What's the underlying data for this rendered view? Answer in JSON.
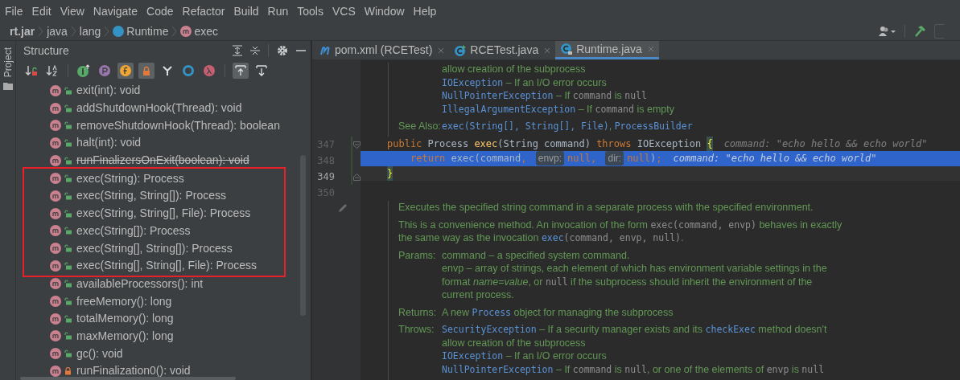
{
  "menu": [
    {
      "label": "File"
    },
    {
      "label": "Edit"
    },
    {
      "label": "View"
    },
    {
      "label": "Navigate"
    },
    {
      "label": "Code"
    },
    {
      "label": "Refactor"
    },
    {
      "label": "Build"
    },
    {
      "label": "Run"
    },
    {
      "label": "Tools"
    },
    {
      "label": "VCS"
    },
    {
      "label": "Window"
    },
    {
      "label": "Help"
    }
  ],
  "breadcrumb": [
    {
      "label": "rt.jar",
      "kind": "jar"
    },
    {
      "label": "java",
      "kind": "package"
    },
    {
      "label": "lang",
      "kind": "package"
    },
    {
      "label": "Runtime",
      "kind": "class"
    },
    {
      "label": "exec",
      "kind": "method"
    }
  ],
  "side_strip": {
    "label": "Project"
  },
  "structure": {
    "title": "Structure",
    "toolbar": [
      {
        "kind": "sort-visibility",
        "on": false
      },
      {
        "kind": "sort-alpha",
        "on": false
      },
      {
        "kind": "inherited",
        "on": false
      },
      {
        "kind": "properties",
        "on": false
      },
      {
        "kind": "fields",
        "on": true
      },
      {
        "kind": "non-public",
        "on": true
      },
      {
        "kind": "anonymous",
        "on": false
      },
      {
        "kind": "interface",
        "on": false
      },
      {
        "kind": "lambda",
        "on": false
      },
      {
        "kind": "scroll-to-source",
        "on": true
      },
      {
        "kind": "scroll-from-source",
        "on": false
      }
    ],
    "items": [
      {
        "label": "exit(int): void",
        "private": false,
        "deprecated": false,
        "boxed": false
      },
      {
        "label": "addShutdownHook(Thread): void",
        "private": false,
        "deprecated": false,
        "boxed": false
      },
      {
        "label": "removeShutdownHook(Thread): boolean",
        "private": false,
        "deprecated": false,
        "boxed": false
      },
      {
        "label": "halt(int): void",
        "private": false,
        "deprecated": false,
        "boxed": false
      },
      {
        "label": "runFinalizersOnExit(boolean): void",
        "private": false,
        "deprecated": true,
        "boxed": false
      },
      {
        "label": "exec(String): Process",
        "private": false,
        "deprecated": false,
        "boxed": true
      },
      {
        "label": "exec(String, String[]): Process",
        "private": false,
        "deprecated": false,
        "boxed": true
      },
      {
        "label": "exec(String, String[], File): Process",
        "private": false,
        "deprecated": false,
        "boxed": true
      },
      {
        "label": "exec(String[]): Process",
        "private": false,
        "deprecated": false,
        "boxed": true
      },
      {
        "label": "exec(String[], String[]): Process",
        "private": false,
        "deprecated": false,
        "boxed": true
      },
      {
        "label": "exec(String[], String[], File): Process",
        "private": false,
        "deprecated": false,
        "boxed": true
      },
      {
        "label": "availableProcessors(): int",
        "private": false,
        "deprecated": false,
        "boxed": false
      },
      {
        "label": "freeMemory(): long",
        "private": false,
        "deprecated": false,
        "boxed": false
      },
      {
        "label": "totalMemory(): long",
        "private": false,
        "deprecated": false,
        "boxed": false
      },
      {
        "label": "maxMemory(): long",
        "private": false,
        "deprecated": false,
        "boxed": false
      },
      {
        "label": "gc(): void",
        "private": false,
        "deprecated": false,
        "boxed": false
      },
      {
        "label": "runFinalization0(): void",
        "private": true,
        "deprecated": false,
        "boxed": false
      }
    ]
  },
  "tabs": [
    {
      "label": "pom.xml (RCETest)",
      "kind": "maven",
      "selected": false
    },
    {
      "label": "RCETest.java",
      "kind": "class",
      "selected": false
    },
    {
      "label": "Runtime.java",
      "kind": "readonly-class",
      "selected": true
    }
  ],
  "doc_top": {
    "sections": [
      {
        "lines": [
          [
            {
              "kind": "text",
              "text": "allow creation of the subprocess"
            }
          ],
          [
            {
              "kind": "link",
              "text": "IOException"
            },
            {
              "kind": "text",
              "text": " – If an I/O error occurs"
            }
          ],
          [
            {
              "kind": "link",
              "text": "NullPointerException"
            },
            {
              "kind": "text",
              "text": " – If "
            },
            {
              "kind": "code",
              "text": "command"
            },
            {
              "kind": "text",
              "text": " is "
            },
            {
              "kind": "code",
              "text": "null"
            }
          ],
          [
            {
              "kind": "link",
              "text": "IllegalArgumentException"
            },
            {
              "kind": "text",
              "text": " – If "
            },
            {
              "kind": "code",
              "text": "command"
            },
            {
              "kind": "text",
              "text": " is empty"
            }
          ]
        ]
      },
      {
        "label": "See Also:",
        "lines": [
          [
            {
              "kind": "link",
              "text": "exec(String[], String[], File)"
            },
            {
              "kind": "text",
              "text": ", "
            },
            {
              "kind": "link",
              "text": "ProcessBuilder"
            }
          ]
        ]
      }
    ]
  },
  "code_lines": [
    {
      "number": "347",
      "selected": false,
      "current": false,
      "fold_start": true,
      "segments": [
        {
          "kind": "keyword",
          "text": "public"
        },
        {
          "kind": "plain",
          "text": " Process "
        },
        {
          "kind": "method",
          "text": "exec"
        },
        {
          "kind": "plain",
          "text": "(String command) "
        },
        {
          "kind": "keyword",
          "text": "throws"
        },
        {
          "kind": "plain",
          "text": " IOException "
        },
        {
          "kind": "brace",
          "text": "{"
        },
        {
          "kind": "value-hint",
          "text": "command: \"echo hello && echo world\""
        }
      ]
    },
    {
      "number": "348",
      "selected": true,
      "current": false,
      "indented": true,
      "segments": [
        {
          "kind": "keyword",
          "text": "return"
        },
        {
          "kind": "plain",
          "text": " exec(command"
        },
        {
          "kind": "keyword",
          "text": ", "
        },
        {
          "kind": "param-hint",
          "text": "envp:"
        },
        {
          "kind": "keyword",
          "text": "null"
        },
        {
          "kind": "keyword",
          "text": ", "
        },
        {
          "kind": "param-hint",
          "text": "dir:"
        },
        {
          "kind": "keyword",
          "text": "null"
        },
        {
          "kind": "plain",
          "text": ")"
        },
        {
          "kind": "keyword",
          "text": ";"
        },
        {
          "kind": "value-hint",
          "text": "command: \"echo hello && echo world\""
        }
      ]
    },
    {
      "number": "349",
      "selected": false,
      "current": true,
      "fold_end": true,
      "segments": [
        {
          "kind": "brace",
          "text": "}"
        }
      ]
    },
    {
      "number": "350",
      "selected": false,
      "current": false
    }
  ],
  "doc_bottom": {
    "sections": [
      {
        "lines": [
          [
            {
              "kind": "text",
              "text": "Executes the specified string command in a separate process with the specified environment."
            }
          ]
        ]
      },
      {
        "lines": [
          [
            {
              "kind": "text",
              "text": "This is a convenience method. An invocation of the form "
            },
            {
              "kind": "code",
              "text": "exec(command, envp)"
            },
            {
              "kind": "text",
              "text": " behaves in exactly"
            }
          ],
          [
            {
              "kind": "text",
              "text": "the same way as the invocation "
            },
            {
              "kind": "link",
              "text": "exec"
            },
            {
              "kind": "code",
              "text": "(command, envp, null)"
            },
            {
              "kind": "text",
              "text": "."
            }
          ]
        ]
      },
      {
        "label": "Params:",
        "lines": [
          [
            {
              "kind": "text",
              "text": "command – a specified system command."
            }
          ],
          [
            {
              "kind": "text",
              "text": "envp – array of strings, each element of which has environment variable settings in the"
            }
          ],
          [
            {
              "kind": "text",
              "text": "format "
            },
            {
              "kind": "em",
              "text": "name"
            },
            {
              "kind": "text",
              "text": "="
            },
            {
              "kind": "em",
              "text": "value"
            },
            {
              "kind": "text",
              "text": ", or "
            },
            {
              "kind": "code",
              "text": "null"
            },
            {
              "kind": "text",
              "text": " if the subprocess should inherit the environment of the"
            }
          ],
          [
            {
              "kind": "text",
              "text": "current process."
            }
          ]
        ]
      },
      {
        "label": "Returns:",
        "lines": [
          [
            {
              "kind": "text",
              "text": "A new "
            },
            {
              "kind": "link",
              "text": "Process"
            },
            {
              "kind": "text",
              "text": " object for managing the subprocess"
            }
          ]
        ]
      },
      {
        "label": "Throws:",
        "lines": [
          [
            {
              "kind": "link",
              "text": "SecurityException"
            },
            {
              "kind": "text",
              "text": " – If a security manager exists and its "
            },
            {
              "kind": "link",
              "text": "checkExec"
            },
            {
              "kind": "text",
              "text": " method doesn't"
            }
          ],
          [
            {
              "kind": "text",
              "text": "allow creation of the subprocess"
            }
          ],
          [
            {
              "kind": "link",
              "text": "IOException"
            },
            {
              "kind": "text",
              "text": " – If an I/O error occurs"
            }
          ],
          [
            {
              "kind": "link",
              "text": "NullPointerException"
            },
            {
              "kind": "text",
              "text": " – If "
            },
            {
              "kind": "code",
              "text": "command"
            },
            {
              "kind": "text",
              "text": " is "
            },
            {
              "kind": "code",
              "text": "null"
            },
            {
              "kind": "text",
              "text": ", or one of the elements of "
            },
            {
              "kind": "code",
              "text": "envp"
            },
            {
              "kind": "text",
              "text": " is "
            },
            {
              "kind": "code",
              "text": "null"
            }
          ]
        ]
      }
    ]
  }
}
